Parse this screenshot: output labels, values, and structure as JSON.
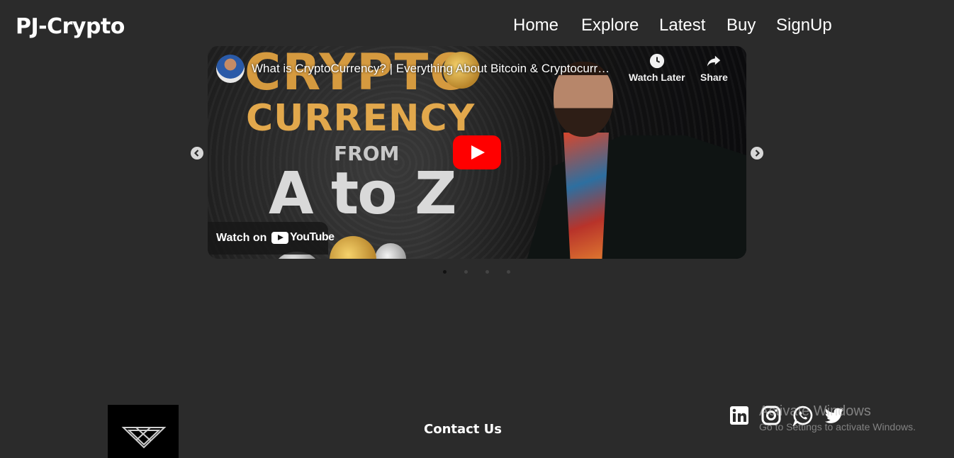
{
  "header": {
    "brand": "PJ-Crypto",
    "nav": [
      {
        "label": "Home"
      },
      {
        "label": "Explore"
      },
      {
        "label": "Latest"
      },
      {
        "label": "Buy"
      },
      {
        "label": "SignUp"
      }
    ]
  },
  "carousel": {
    "slides_count": 4,
    "active_slide": 1,
    "video": {
      "title": "What is CryptoCurrency? | Everything About Bitcoin & Cryptocurr…",
      "thumbnail_text": {
        "line1": "CRYPTO",
        "line2": "CURRENCY",
        "line3": "FROM",
        "line4": "A to Z"
      },
      "watch_later_label": "Watch Later",
      "share_label": "Share",
      "watch_on_label": "Watch on",
      "youtube_label": "YouTube",
      "accent_color": "#ff0000"
    },
    "prev_icon": "chevron-left-icon",
    "next_icon": "chevron-right-icon"
  },
  "footer": {
    "contact_heading": "Contact Us",
    "social_icons": [
      "linkedin-icon",
      "instagram-icon",
      "whatsapp-icon",
      "twitter-icon"
    ]
  },
  "os_overlay": {
    "line1": "Activate Windows",
    "line2": "Go to Settings to activate Windows."
  }
}
